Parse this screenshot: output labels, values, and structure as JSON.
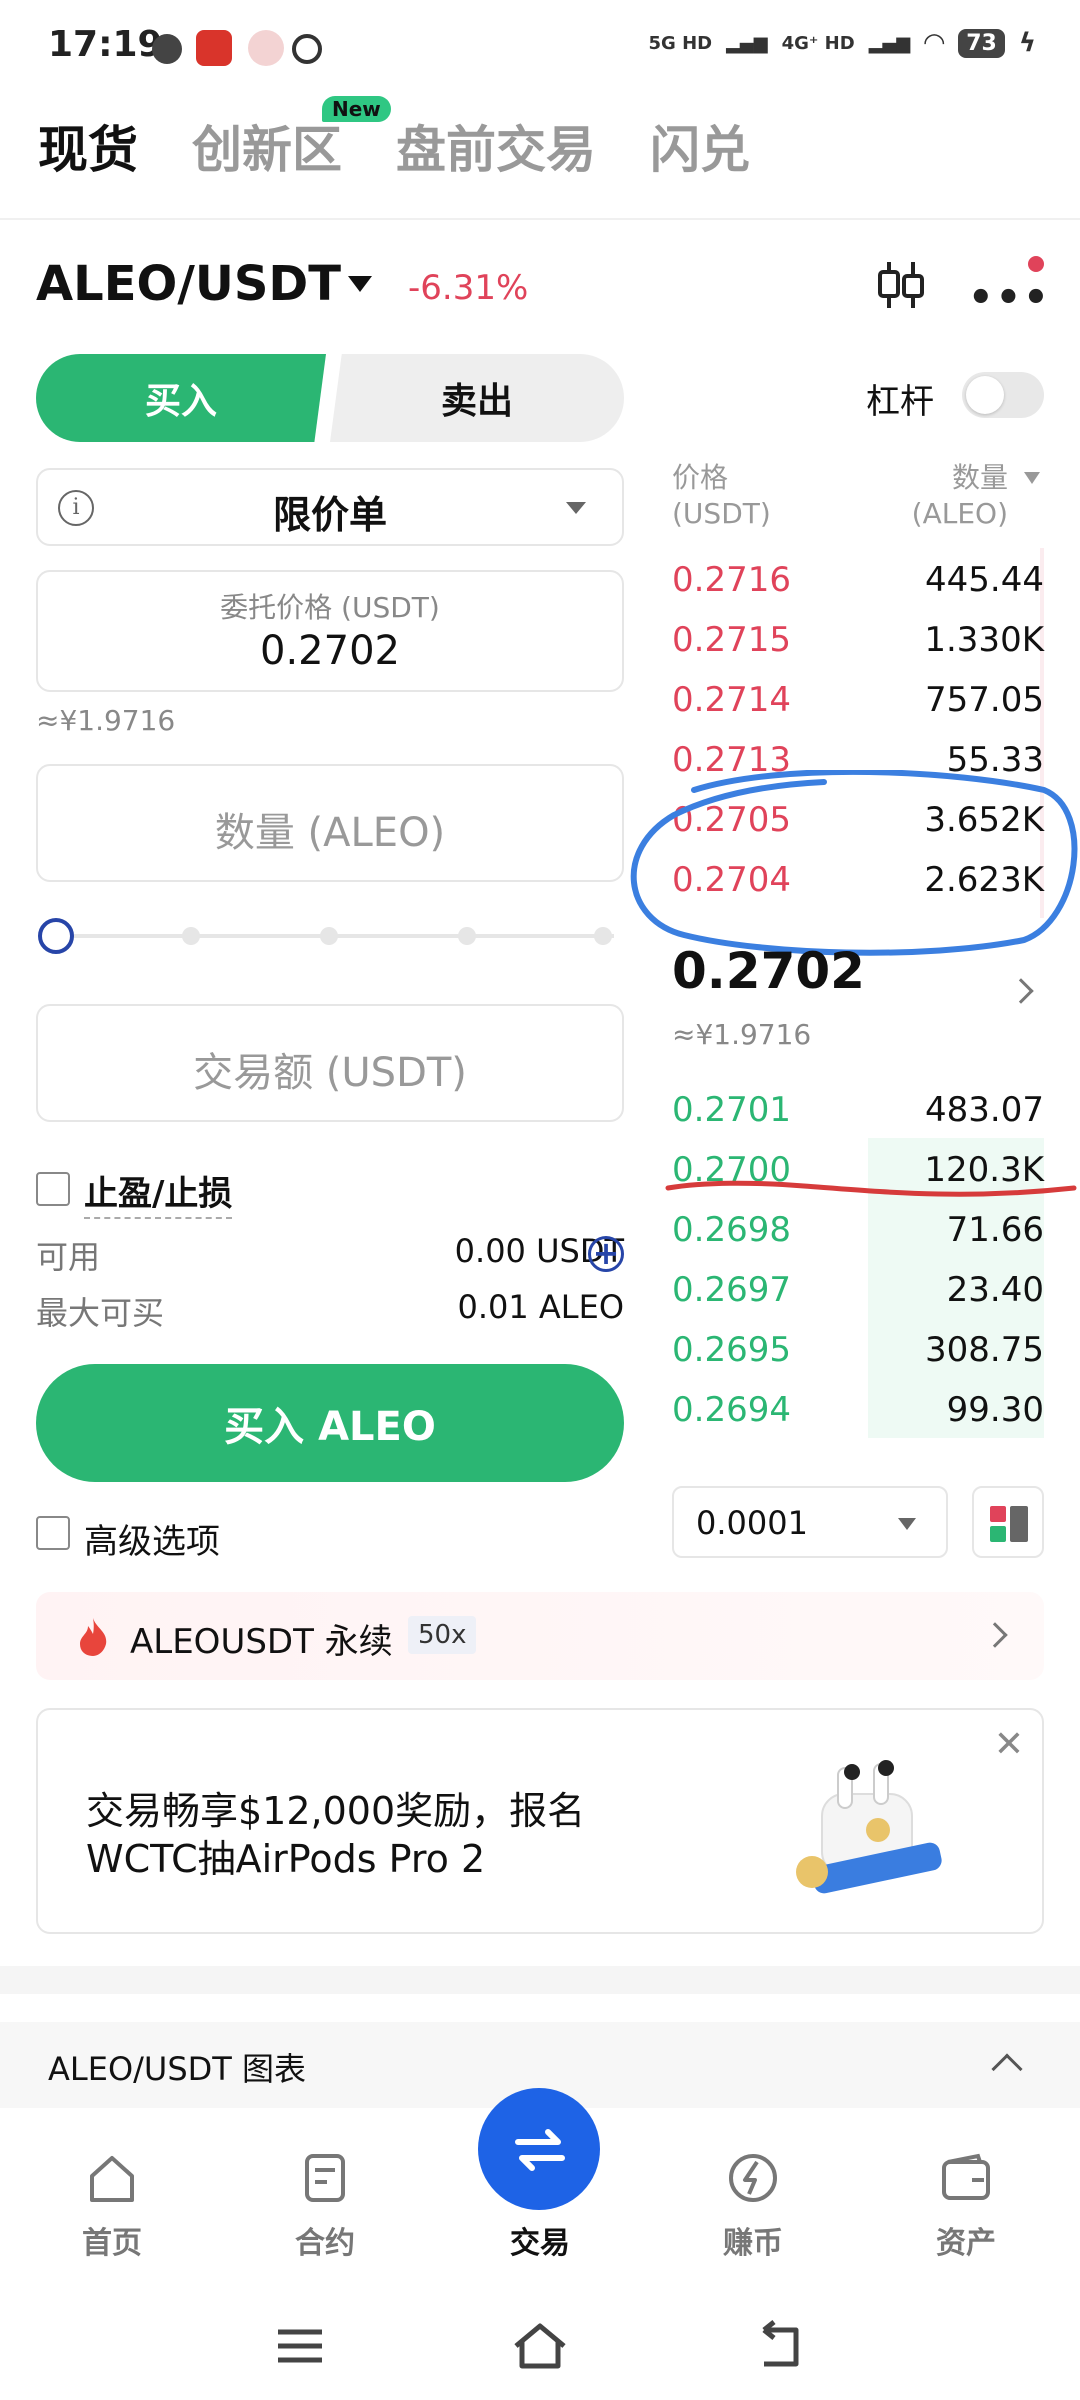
{
  "status_bar": {
    "time": "17:19",
    "network_1": "5G HD",
    "network_2": "4G⁺ HD",
    "battery": "73"
  },
  "top_tabs": [
    {
      "label": "现货",
      "active": true
    },
    {
      "label": "创新区",
      "active": false,
      "badge": "New"
    },
    {
      "label": "盘前交易",
      "active": false
    },
    {
      "label": "闪兑",
      "active": false
    }
  ],
  "pair": {
    "symbol": "ALEO/USDT",
    "change": "-6.31%"
  },
  "trade_side": {
    "buy": "买入",
    "sell": "卖出"
  },
  "leverage": {
    "label": "杠杆",
    "enabled": false
  },
  "order_form": {
    "order_type": "限价单",
    "price_label": "委托价格 (USDT)",
    "price_value": "0.2702",
    "price_approx": "≈¥1.9716",
    "quantity_placeholder": "数量 (ALEO)",
    "slider_percent": 0,
    "amount_placeholder": "交易额 (USDT)",
    "tpsl_label": "止盈/止损",
    "available_label": "可用",
    "available_value": "0.00 USDT",
    "max_buy_label": "最大可买",
    "max_buy_value": "0.01 ALEO",
    "submit_label": "买入 ALEO",
    "advanced_label": "高级选项"
  },
  "order_book": {
    "price_header": "价格",
    "price_unit": "(USDT)",
    "qty_header": "数量",
    "qty_unit": "(ALEO)",
    "asks": [
      {
        "price": "0.2716",
        "qty": "445.44"
      },
      {
        "price": "0.2715",
        "qty": "1.330K"
      },
      {
        "price": "0.2714",
        "qty": "757.05"
      },
      {
        "price": "0.2713",
        "qty": "55.33"
      },
      {
        "price": "0.2705",
        "qty": "3.652K"
      },
      {
        "price": "0.2704",
        "qty": "2.623K"
      }
    ],
    "last_price": "0.2702",
    "last_price_approx": "≈¥1.9716",
    "bids": [
      {
        "price": "0.2701",
        "qty": "483.07"
      },
      {
        "price": "0.2700",
        "qty": "120.3K"
      },
      {
        "price": "0.2698",
        "qty": "71.66"
      },
      {
        "price": "0.2697",
        "qty": "23.40"
      },
      {
        "price": "0.2695",
        "qty": "308.75"
      },
      {
        "price": "0.2694",
        "qty": "99.30"
      }
    ],
    "precision": "0.0001"
  },
  "perpetual_banner": {
    "label": "ALEOUSDT 永续",
    "leverage": "50x"
  },
  "promo": {
    "line1": "交易畅享$12,000奖励，报名",
    "line2": "WCTC抽AirPods Pro 2"
  },
  "chart_section": {
    "label": "ALEO/USDT 图表"
  },
  "bottom_nav": [
    {
      "label": "首页",
      "icon": "home-icon"
    },
    {
      "label": "合约",
      "icon": "contract-icon"
    },
    {
      "label": "交易",
      "icon": "trade-icon",
      "active": true
    },
    {
      "label": "赚币",
      "icon": "earn-icon"
    },
    {
      "label": "资产",
      "icon": "wallet-icon"
    }
  ],
  "colors": {
    "buy": "#2bb673",
    "sell": "#e0435a",
    "accent": "#1e63e6"
  }
}
